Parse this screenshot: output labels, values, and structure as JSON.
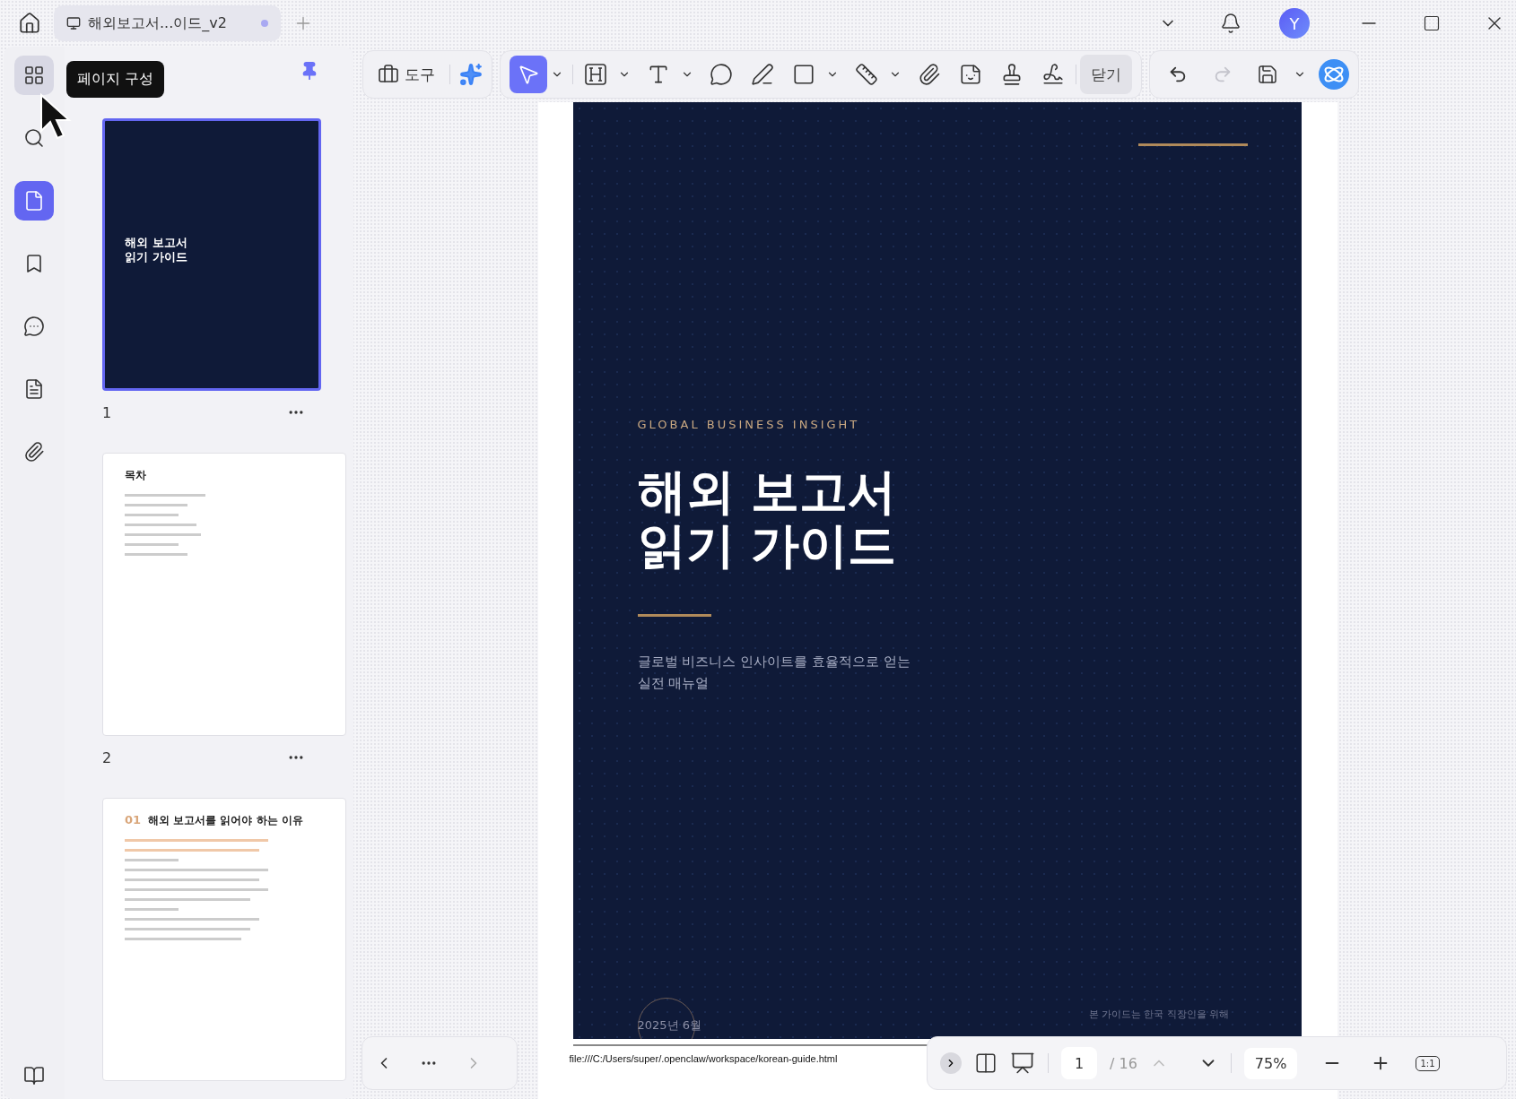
{
  "tabs": [
    {
      "title": "해외보고서...이드_v2",
      "selected": true,
      "modified": true
    }
  ],
  "avatar": {
    "initial": "Y"
  },
  "sidebar": {
    "items": [
      {
        "kind": "organize",
        "selected": false,
        "hovered": true
      },
      {
        "kind": "search",
        "selected": false,
        "hovered": false
      },
      {
        "kind": "pages",
        "selected": true,
        "hovered": false
      },
      {
        "kind": "bookmark",
        "selected": false,
        "hovered": false
      },
      {
        "kind": "comments",
        "selected": false,
        "hovered": false
      },
      {
        "kind": "form",
        "selected": false,
        "hovered": false
      },
      {
        "kind": "attachments",
        "selected": false,
        "hovered": false
      }
    ]
  },
  "tooltip": "페이지 구성",
  "thumbnails": [
    {
      "kind": "cover",
      "selected": true,
      "label": "1",
      "title_lines": [
        "해외 보고서",
        "읽기 가이드"
      ]
    },
    {
      "kind": "toc",
      "selected": false,
      "label": "2",
      "heading": "목차"
    },
    {
      "kind": "chapter",
      "selected": false,
      "number": "01",
      "heading": "해외 보고서를 읽어야 하는 이유"
    }
  ],
  "toolbar": {
    "tools_label": "도구",
    "close_label": "닫기",
    "tools": [
      {
        "kind": "select",
        "selected": true,
        "dropdown": true
      },
      {
        "kind": "heading",
        "selected": false,
        "dropdown": true
      },
      {
        "kind": "text",
        "selected": false,
        "dropdown": true
      },
      {
        "kind": "comment",
        "selected": false,
        "dropdown": false
      },
      {
        "kind": "pencil",
        "selected": false,
        "dropdown": false
      },
      {
        "kind": "rectangle",
        "selected": false,
        "dropdown": true
      },
      {
        "kind": "measure",
        "selected": false,
        "dropdown": true
      },
      {
        "kind": "attach",
        "selected": false,
        "dropdown": false
      },
      {
        "kind": "sticker",
        "selected": false,
        "dropdown": false
      },
      {
        "kind": "stamp",
        "selected": false,
        "dropdown": false
      },
      {
        "kind": "signature",
        "selected": false,
        "dropdown": false
      }
    ],
    "undo_disabled": false,
    "redo_disabled": true
  },
  "page": {
    "eyebrow": "GLOBAL BUSINESS INSIGHT",
    "title_lines": [
      "해외 보고서",
      "읽기 가이드"
    ],
    "subtitle_lines": [
      "글로벌 비즈니스 인사이트를 효율적으로 얻는",
      "실전 매뉴얼"
    ],
    "date": "2025년 6월",
    "note": "본 가이드는 한국 직장인을 위해",
    "url": "file:///C:/Users/super/.openclaw/workspace/korean-guide.html"
  },
  "pager": {
    "current": "1",
    "total": "/ 16",
    "zoom": "75%",
    "actual_size": "1:1",
    "prev_disabled": true
  }
}
